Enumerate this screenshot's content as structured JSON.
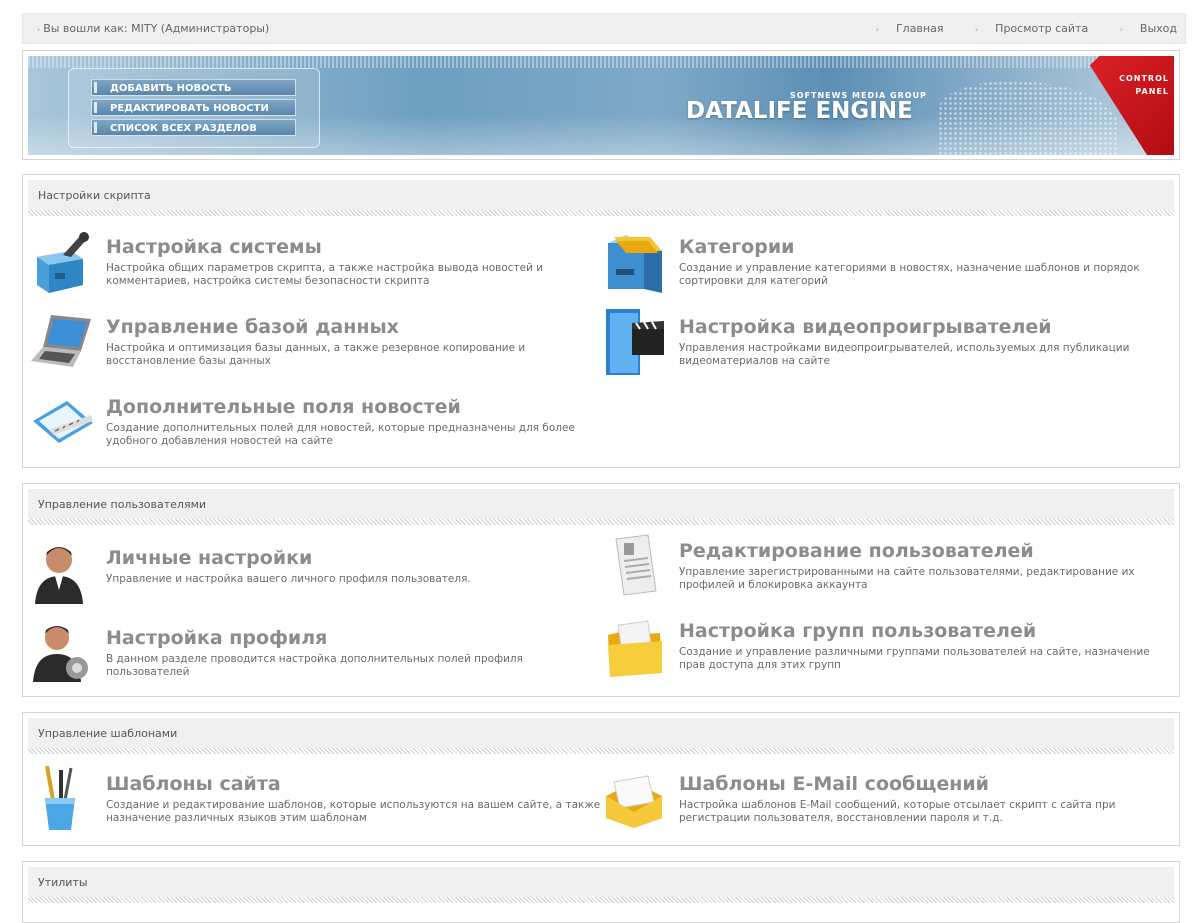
{
  "topbar": {
    "login": "Вы вошли как: MITY (Администраторы)",
    "links": [
      "Главная",
      "Просмотр сайта",
      "Выход"
    ]
  },
  "banner": {
    "menu": [
      "ДОБАВИТЬ НОВОСТЬ",
      "РЕДАКТИРОВАТЬ НОВОСТИ",
      "СПИСОК ВСЕХ РАЗДЕЛОВ"
    ],
    "brand_sub": "SOFTNEWS MEDIA GROUP",
    "brand": "DATALIFE ENGINE",
    "corner_line1": "CONTROL",
    "corner_line2": "PANEL"
  },
  "sections": {
    "script": {
      "title": "Настройки скрипта",
      "items": [
        {
          "title": "Настройка системы",
          "desc": "Настройка общих параметров скрипта, а также настройка вывода новостей и комментариев, настройка системы безопасности скрипта",
          "icon": "toolbox-icon"
        },
        {
          "title": "Категории",
          "desc": "Создание и управление категориями в новостях, назначение шаблонов и порядок сортировки для категорий",
          "icon": "file-cabinet-icon"
        },
        {
          "title": "Управление базой данных",
          "desc": "Настройка и оптимизация базы данных, а также резервное копирование и восстановление базы данных",
          "icon": "laptop-icon"
        },
        {
          "title": "Настройка видеопроигрывателей",
          "desc": "Управления настройками видеопроигрывателей, используемых для публикации видеоматериалов на сайте",
          "icon": "video-clapper-icon"
        },
        {
          "title": "Дополнительные поля новостей",
          "desc": "Создание дополнительных полей для новостей, которые предназначены для более удобного добавления новостей на сайте",
          "icon": "ruler-notepad-icon"
        }
      ]
    },
    "users": {
      "title": "Управление пользователями",
      "items": [
        {
          "title": "Личные настройки",
          "desc": "Управление и настройка вашего личного профиля пользователя.",
          "icon": "user-icon"
        },
        {
          "title": "Редактирование пользователей",
          "desc": "Управление зарегистрированными на сайте пользователями, редактирование их профилей и блокировка аккаунта",
          "icon": "document-icon"
        },
        {
          "title": "Настройка профиля",
          "desc": "В данном разделе проводится настройка дополнительных полей профиля пользователей",
          "icon": "user-gear-icon"
        },
        {
          "title": "Настройка групп пользователей",
          "desc": "Создание и управление различными группами пользователей на сайте, назначение прав доступа для этих групп",
          "icon": "folder-icon"
        }
      ]
    },
    "templates": {
      "title": "Управление шаблонами",
      "items": [
        {
          "title": "Шаблоны сайта",
          "desc": "Создание и редактирование шаблонов, которые используются на вашем сайте, а также назначение различных языков этим шаблонам",
          "icon": "brushes-cup-icon"
        },
        {
          "title": "Шаблоны E-Mail сообщений",
          "desc": "Настройка шаблонов E-Mail сообщений, которые отсылает скрипт с сайта при регистрации пользователя, восстановлении пароля и т.д.",
          "icon": "envelope-icon"
        }
      ]
    },
    "utils": {
      "title": "Утилиты"
    }
  }
}
